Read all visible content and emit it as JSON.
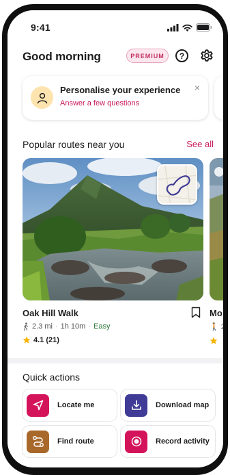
{
  "status_bar": {
    "time": "9:41"
  },
  "header": {
    "greeting": "Good morning",
    "premium_badge": "PREMIUM",
    "help_icon": "question-circle-icon",
    "settings_icon": "gear-icon"
  },
  "banner": {
    "title": "Personalise your experience",
    "link": "Answer a few questions",
    "close": "×"
  },
  "popular_routes": {
    "title": "Popular routes near you",
    "see_all": "See all",
    "routes": [
      {
        "name": "Oak Hill Walk",
        "distance": "2.3 mi",
        "duration": "1h 10m",
        "difficulty": "Easy",
        "rating": "4.1 (21)"
      },
      {
        "name": "Mo",
        "distance": "2"
      }
    ]
  },
  "quick_actions": {
    "title": "Quick actions",
    "items": [
      {
        "label": "Locate me",
        "icon": "navigation-arrow-icon",
        "color": "#d4145a"
      },
      {
        "label": "Download map",
        "icon": "download-icon",
        "color": "#3f3b96"
      },
      {
        "label": "Find route",
        "icon": "route-icon",
        "color": "#a8682a"
      },
      {
        "label": "Record activity",
        "icon": "record-icon",
        "color": "#d4145a"
      }
    ]
  },
  "colors": {
    "accent": "#c8185a",
    "easy": "#2f7a3a",
    "star": "#f5b400"
  }
}
